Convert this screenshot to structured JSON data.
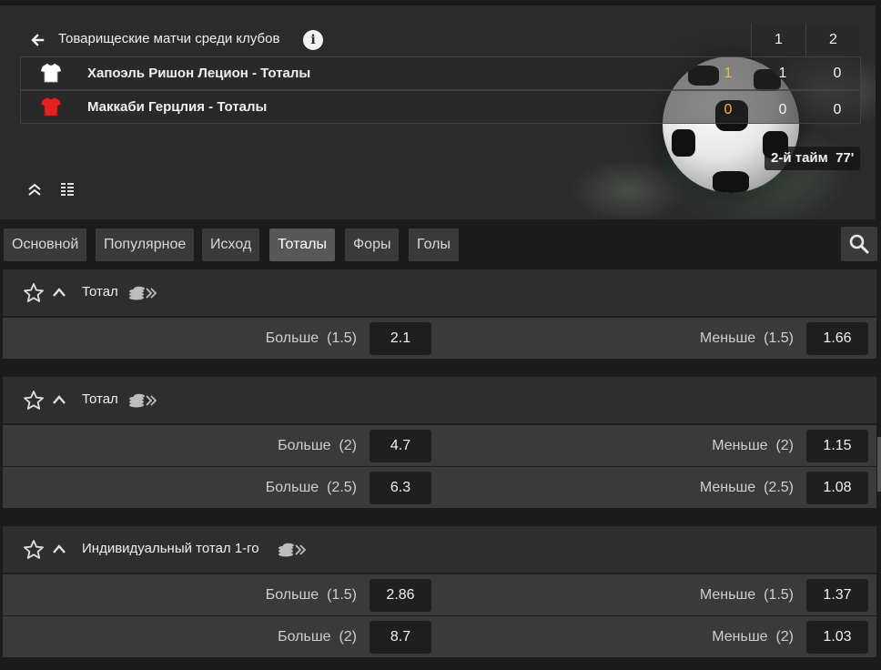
{
  "header": {
    "league_title": "Товарищеские матчи среди клубов",
    "info_glyph": "i",
    "score_columns": [
      "1",
      "2"
    ],
    "teams": [
      {
        "name": "Хапоэль Ришон Лецион - Тоталы",
        "jersey_color": "#ffffff",
        "current": "1",
        "scores": [
          "1",
          "0"
        ]
      },
      {
        "name": "Маккаби Герцлия - Тоталы",
        "jersey_color": "#e52020",
        "current": "0",
        "scores": [
          "0",
          "0"
        ]
      }
    ],
    "period": "2-й тайм  77'",
    "icons": [
      "back-arrow-icon",
      "info-icon",
      "collapse-icon",
      "grid-icon",
      "soccer-ball-icon"
    ]
  },
  "tabs": [
    {
      "label": "Основной",
      "active": false
    },
    {
      "label": "Популярное",
      "active": false
    },
    {
      "label": "Исход",
      "active": false
    },
    {
      "label": "Тоталы",
      "active": true
    },
    {
      "label": "Форы",
      "active": false
    },
    {
      "label": "Голы",
      "active": false
    }
  ],
  "markets": [
    {
      "title": "Тотал",
      "rows": [
        {
          "left_label": "Больше  (1.5)",
          "left_odd": "2.1",
          "right_label": "Меньше  (1.5)",
          "right_odd": "1.66"
        }
      ]
    },
    {
      "title": "Тотал",
      "rows": [
        {
          "left_label": "Больше  (2)",
          "left_odd": "4.7",
          "right_label": "Меньше  (2)",
          "right_odd": "1.15"
        },
        {
          "left_label": "Больше  (2.5)",
          "left_odd": "6.3",
          "right_label": "Меньше  (2.5)",
          "right_odd": "1.08"
        }
      ]
    },
    {
      "title": "Индивидуальный тотал 1-го",
      "rows": [
        {
          "left_label": "Больше  (1.5)",
          "left_odd": "2.86",
          "right_label": "Меньше  (1.5)",
          "right_odd": "1.37"
        },
        {
          "left_label": "Больше  (2)",
          "left_odd": "8.7",
          "right_label": "Меньше  (2)",
          "right_odd": "1.03"
        }
      ]
    }
  ],
  "colors": {
    "accent_current_score": "#f5b82e",
    "active_tab": "#575757",
    "odds_button": "#1f1f1f"
  }
}
